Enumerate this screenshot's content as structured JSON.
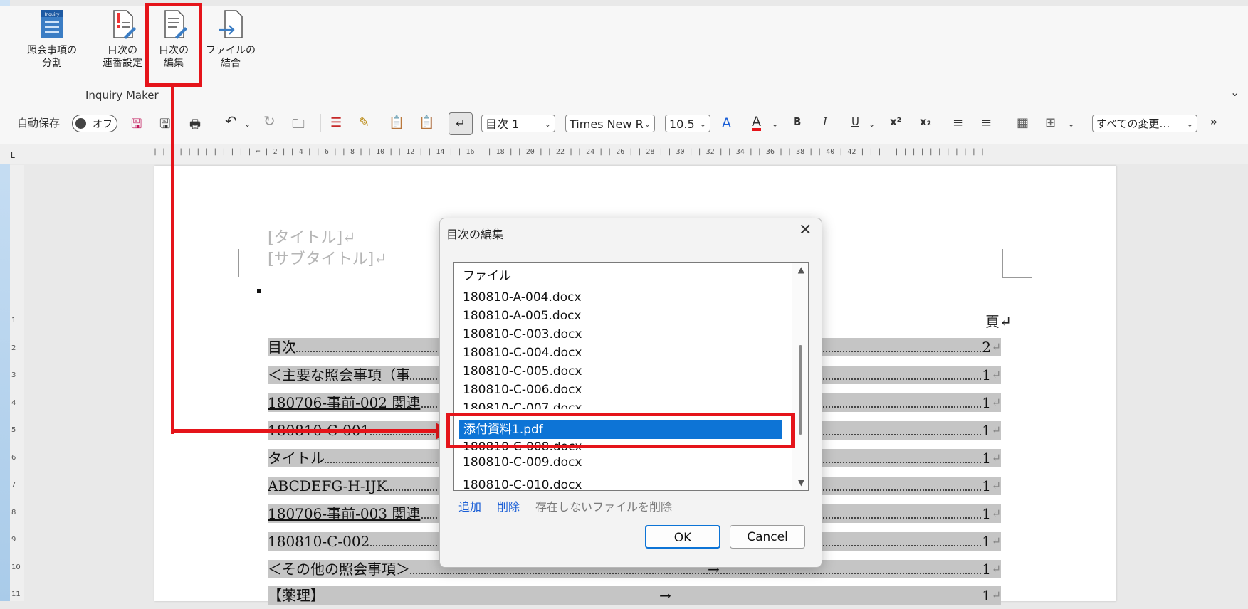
{
  "ribbon": {
    "buttons": [
      {
        "label1": "照会事項の",
        "label2": "分割"
      },
      {
        "label1": "目次の",
        "label2": "連番設定"
      },
      {
        "label1": "目次の",
        "label2": "編集"
      },
      {
        "label1": "ファイルの",
        "label2": "結合"
      }
    ],
    "inquiry_badge": "Inquiry",
    "group_label": "Inquiry Maker"
  },
  "qat": {
    "autosave_label": "自動保存",
    "autosave_state": "オフ",
    "style_value": "目次 1",
    "font_value": "Times New R",
    "size_value": "10.5",
    "bold": "B",
    "italic": "I",
    "underline": "U",
    "track_changes_value": "すべての変更…",
    "more": "»"
  },
  "ruler": {
    "corner": "L",
    "ticks": "| | | | | | | | | | | | ⌐ | 2 | | 4 | | 6 | | 8 | | 10 | | 12 | | 14 | | 16 | | 18 | | 20 | | 22 | | 24 | | 26 | | 28 | | 30 | | 32 | | 34 | | 36 | | 38 | | 40 | 42 | | | | | | | | | | | | | | |",
    "vertical_numbers": [
      "1",
      "2",
      "3",
      "4",
      "5",
      "6",
      "7",
      "8",
      "9",
      "10",
      "11"
    ]
  },
  "document": {
    "title_placeholder": "[タイトル]↵",
    "subtitle_placeholder": "[サブタイトル]↵",
    "page_header": "頁↵",
    "toc": [
      {
        "text": "目次",
        "page": "2"
      },
      {
        "text": "＜主要な照会事項（事",
        "page": "1"
      },
      {
        "text": "180706-事前-002 関連",
        "page": "1"
      },
      {
        "text": "180810-C-001",
        "page": "1"
      },
      {
        "text": "タイトル",
        "page": "1"
      },
      {
        "text": "ABCDEFG-H-IJK",
        "page": "1"
      },
      {
        "text": "180706-事前-003 関連",
        "page": "1"
      },
      {
        "text": "180810-C-002",
        "page": "1"
      },
      {
        "text": "＜その他の照会事項＞",
        "page": "1"
      },
      {
        "text": "【薬理】",
        "page": "1"
      }
    ],
    "return_mark": "↵",
    "tab_arrow": "→"
  },
  "dialog": {
    "title": "目次の編集",
    "close": "✕",
    "list_header": "ファイル",
    "items": [
      "180810-A-004.docx",
      "180810-A-005.docx",
      "180810-C-003.docx",
      "180810-C-004.docx",
      "180810-C-005.docx",
      "180810-C-006.docx",
      "180810-C-007.docx"
    ],
    "selected_item": "添付資料1.pdf",
    "items_after": [
      "180810-C-008.docx",
      "180810-C-009.docx",
      "180810-C-010.docx"
    ],
    "add_link": "追加",
    "delete_link": "削除",
    "remove_missing_link": "存在しないファイルを削除",
    "ok_label": "OK",
    "cancel_label": "Cancel"
  },
  "colors": {
    "annotation_red": "#e5141a",
    "selection_blue": "#0d74d6",
    "toc_highlight": "#c5c5c5"
  }
}
